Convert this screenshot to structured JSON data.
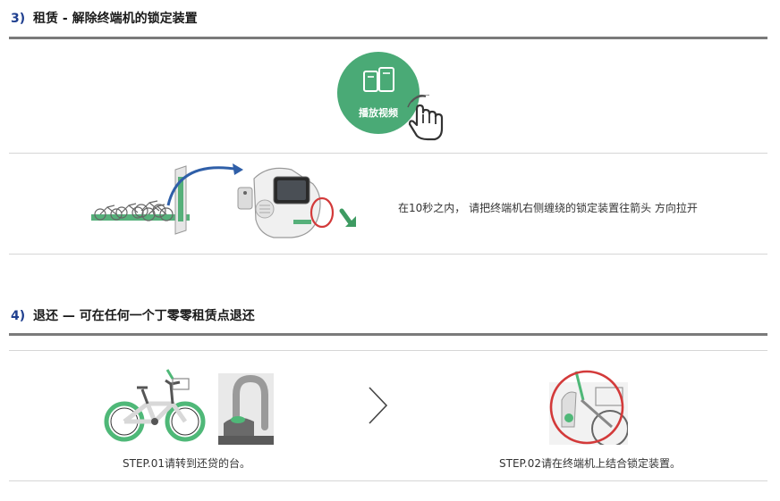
{
  "section3": {
    "number": "3)",
    "title": "租赁 - 解除终端机的锁定装置",
    "video_button_label": "播放视频",
    "instruction": "在10秒之内， 请把终端机右侧缠绕的锁定装置往箭头 方向拉开"
  },
  "section4": {
    "number": "4)",
    "title": "退还 — 可在任何一个丁零零租赁点退还",
    "step1_caption": "STEP.01请转到还贷的台。",
    "step2_caption": "STEP.02请在终端机上结合锁定装置。"
  },
  "colors": {
    "accent_green": "#4aaa76",
    "title_number_blue": "#1f3f8f",
    "highlight_red": "#d33a3a"
  }
}
